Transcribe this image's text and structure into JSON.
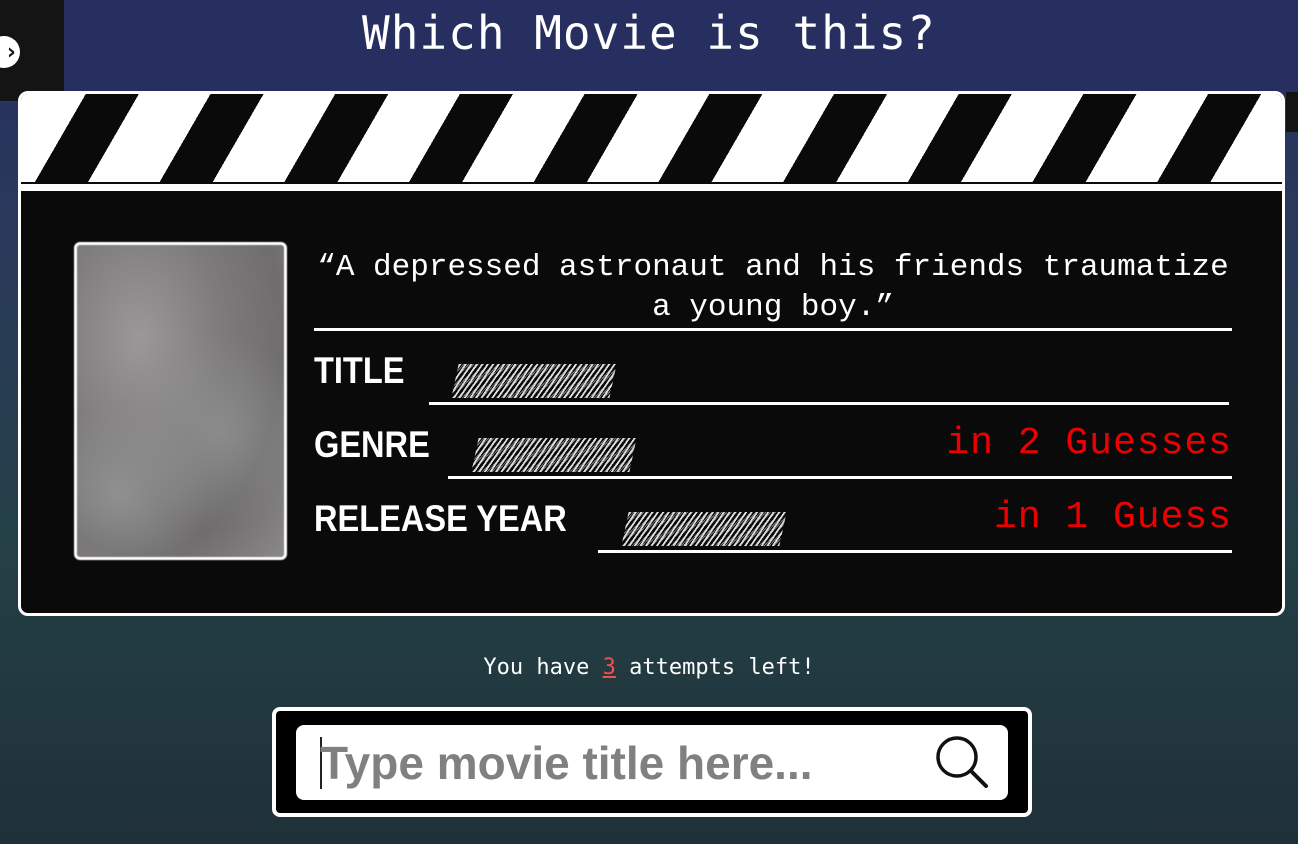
{
  "header": {
    "title": "Which Movie is this?"
  },
  "sidebar_toggle": {
    "icon": "chevron-right-icon",
    "glyph": "›"
  },
  "card": {
    "quote": "“A depressed astronaut and his friends traumatize a young boy.”",
    "fields": [
      {
        "label": "TITLE",
        "hint": ""
      },
      {
        "label": "GENRE",
        "hint": "in 2 Guesses"
      },
      {
        "label": "RELEASE YEAR",
        "hint": "in 1 Guess"
      }
    ]
  },
  "attempts": {
    "prefix": "You have",
    "count": "3",
    "suffix": "attempts left!"
  },
  "search": {
    "placeholder": "Type movie title here...",
    "value": "",
    "icon": "search-icon"
  },
  "colors": {
    "header_bg": "#262f60",
    "hint": "#ee0000",
    "count": "#f05050"
  }
}
